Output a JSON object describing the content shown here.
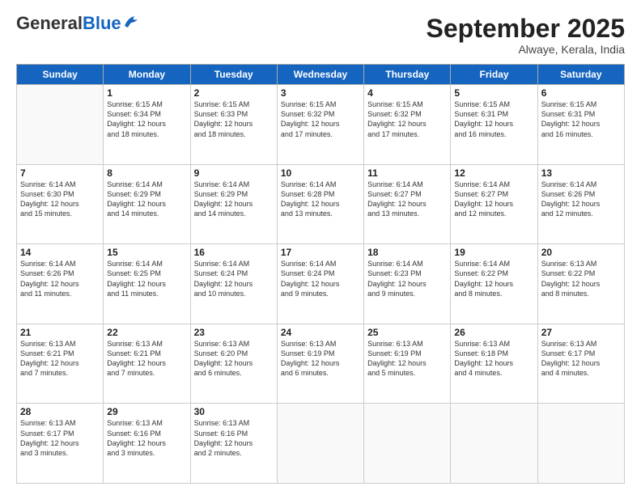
{
  "logo": {
    "general": "General",
    "blue": "Blue"
  },
  "header": {
    "month": "September 2025",
    "location": "Alwaye, Kerala, India"
  },
  "weekdays": [
    "Sunday",
    "Monday",
    "Tuesday",
    "Wednesday",
    "Thursday",
    "Friday",
    "Saturday"
  ],
  "weeks": [
    [
      {
        "day": null
      },
      {
        "day": 1,
        "sunrise": "6:15 AM",
        "sunset": "6:34 PM",
        "daylight": "12 hours and 18 minutes."
      },
      {
        "day": 2,
        "sunrise": "6:15 AM",
        "sunset": "6:33 PM",
        "daylight": "12 hours and 18 minutes."
      },
      {
        "day": 3,
        "sunrise": "6:15 AM",
        "sunset": "6:32 PM",
        "daylight": "12 hours and 17 minutes."
      },
      {
        "day": 4,
        "sunrise": "6:15 AM",
        "sunset": "6:32 PM",
        "daylight": "12 hours and 17 minutes."
      },
      {
        "day": 5,
        "sunrise": "6:15 AM",
        "sunset": "6:31 PM",
        "daylight": "12 hours and 16 minutes."
      },
      {
        "day": 6,
        "sunrise": "6:15 AM",
        "sunset": "6:31 PM",
        "daylight": "12 hours and 16 minutes."
      }
    ],
    [
      {
        "day": 7,
        "sunrise": "6:14 AM",
        "sunset": "6:30 PM",
        "daylight": "12 hours and 15 minutes."
      },
      {
        "day": 8,
        "sunrise": "6:14 AM",
        "sunset": "6:29 PM",
        "daylight": "12 hours and 14 minutes."
      },
      {
        "day": 9,
        "sunrise": "6:14 AM",
        "sunset": "6:29 PM",
        "daylight": "12 hours and 14 minutes."
      },
      {
        "day": 10,
        "sunrise": "6:14 AM",
        "sunset": "6:28 PM",
        "daylight": "12 hours and 13 minutes."
      },
      {
        "day": 11,
        "sunrise": "6:14 AM",
        "sunset": "6:27 PM",
        "daylight": "12 hours and 13 minutes."
      },
      {
        "day": 12,
        "sunrise": "6:14 AM",
        "sunset": "6:27 PM",
        "daylight": "12 hours and 12 minutes."
      },
      {
        "day": 13,
        "sunrise": "6:14 AM",
        "sunset": "6:26 PM",
        "daylight": "12 hours and 12 minutes."
      }
    ],
    [
      {
        "day": 14,
        "sunrise": "6:14 AM",
        "sunset": "6:26 PM",
        "daylight": "12 hours and 11 minutes."
      },
      {
        "day": 15,
        "sunrise": "6:14 AM",
        "sunset": "6:25 PM",
        "daylight": "12 hours and 11 minutes."
      },
      {
        "day": 16,
        "sunrise": "6:14 AM",
        "sunset": "6:24 PM",
        "daylight": "12 hours and 10 minutes."
      },
      {
        "day": 17,
        "sunrise": "6:14 AM",
        "sunset": "6:24 PM",
        "daylight": "12 hours and 9 minutes."
      },
      {
        "day": 18,
        "sunrise": "6:14 AM",
        "sunset": "6:23 PM",
        "daylight": "12 hours and 9 minutes."
      },
      {
        "day": 19,
        "sunrise": "6:14 AM",
        "sunset": "6:22 PM",
        "daylight": "12 hours and 8 minutes."
      },
      {
        "day": 20,
        "sunrise": "6:13 AM",
        "sunset": "6:22 PM",
        "daylight": "12 hours and 8 minutes."
      }
    ],
    [
      {
        "day": 21,
        "sunrise": "6:13 AM",
        "sunset": "6:21 PM",
        "daylight": "12 hours and 7 minutes."
      },
      {
        "day": 22,
        "sunrise": "6:13 AM",
        "sunset": "6:21 PM",
        "daylight": "12 hours and 7 minutes."
      },
      {
        "day": 23,
        "sunrise": "6:13 AM",
        "sunset": "6:20 PM",
        "daylight": "12 hours and 6 minutes."
      },
      {
        "day": 24,
        "sunrise": "6:13 AM",
        "sunset": "6:19 PM",
        "daylight": "12 hours and 6 minutes."
      },
      {
        "day": 25,
        "sunrise": "6:13 AM",
        "sunset": "6:19 PM",
        "daylight": "12 hours and 5 minutes."
      },
      {
        "day": 26,
        "sunrise": "6:13 AM",
        "sunset": "6:18 PM",
        "daylight": "12 hours and 4 minutes."
      },
      {
        "day": 27,
        "sunrise": "6:13 AM",
        "sunset": "6:17 PM",
        "daylight": "12 hours and 4 minutes."
      }
    ],
    [
      {
        "day": 28,
        "sunrise": "6:13 AM",
        "sunset": "6:17 PM",
        "daylight": "12 hours and 3 minutes."
      },
      {
        "day": 29,
        "sunrise": "6:13 AM",
        "sunset": "6:16 PM",
        "daylight": "12 hours and 3 minutes."
      },
      {
        "day": 30,
        "sunrise": "6:13 AM",
        "sunset": "6:16 PM",
        "daylight": "12 hours and 2 minutes."
      },
      {
        "day": null
      },
      {
        "day": null
      },
      {
        "day": null
      },
      {
        "day": null
      }
    ]
  ]
}
